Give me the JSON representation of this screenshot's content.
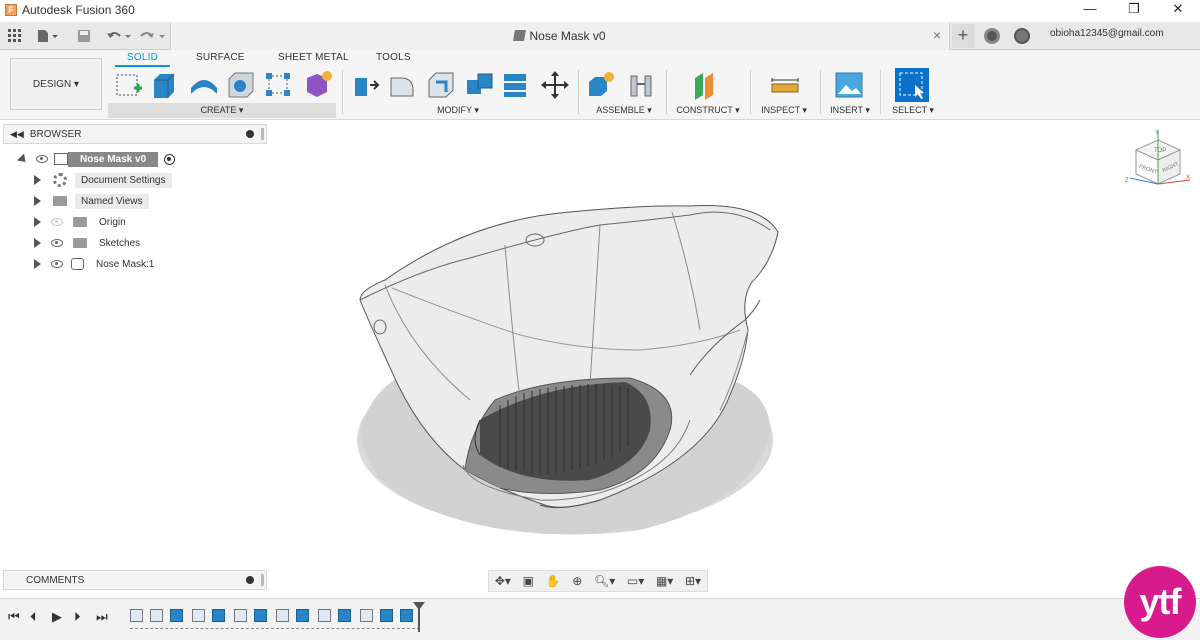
{
  "app": {
    "title": "Autodesk Fusion 360",
    "logo_letter": "F"
  },
  "window_controls": {
    "minimize": "—",
    "restore": "❐",
    "close": "✕"
  },
  "document": {
    "tab_title": "Nose Mask v0",
    "tab_close": "×",
    "add": "+"
  },
  "account": {
    "email": "obioha12345@gmail.com"
  },
  "workspace": {
    "label": "DESIGN ▾"
  },
  "ribbon_tabs": [
    "SOLID",
    "SURFACE",
    "SHEET METAL",
    "TOOLS"
  ],
  "ribbon_groups": {
    "create": "CREATE ▾",
    "modify": "MODIFY ▾",
    "assemble": "ASSEMBLE ▾",
    "construct": "CONSTRUCT ▾",
    "inspect": "INSPECT ▾",
    "insert": "INSERT ▾",
    "select": "SELECT ▾"
  },
  "browser": {
    "title": "BROWSER",
    "root": "Nose Mask v0",
    "items": [
      {
        "label": "Document Settings",
        "icon": "gear-icon"
      },
      {
        "label": "Named Views",
        "icon": "folder-icon"
      },
      {
        "label": "Origin",
        "icon": "folder-icon"
      },
      {
        "label": "Sketches",
        "icon": "folder-icon"
      },
      {
        "label": "Nose Mask:1",
        "icon": "component-icon"
      }
    ]
  },
  "comments": {
    "title": "COMMENTS"
  },
  "viewcube": {
    "top": "TOP",
    "front": "FRONT",
    "right": "RIGHT",
    "axis_x": "X",
    "axis_y": "Y",
    "axis_z": "Z"
  },
  "watermark": {
    "text": "ytf"
  },
  "colors": {
    "accent": "#0696d7",
    "watermark": "#d81b8c",
    "timeline_feature": "#2a85c7"
  }
}
